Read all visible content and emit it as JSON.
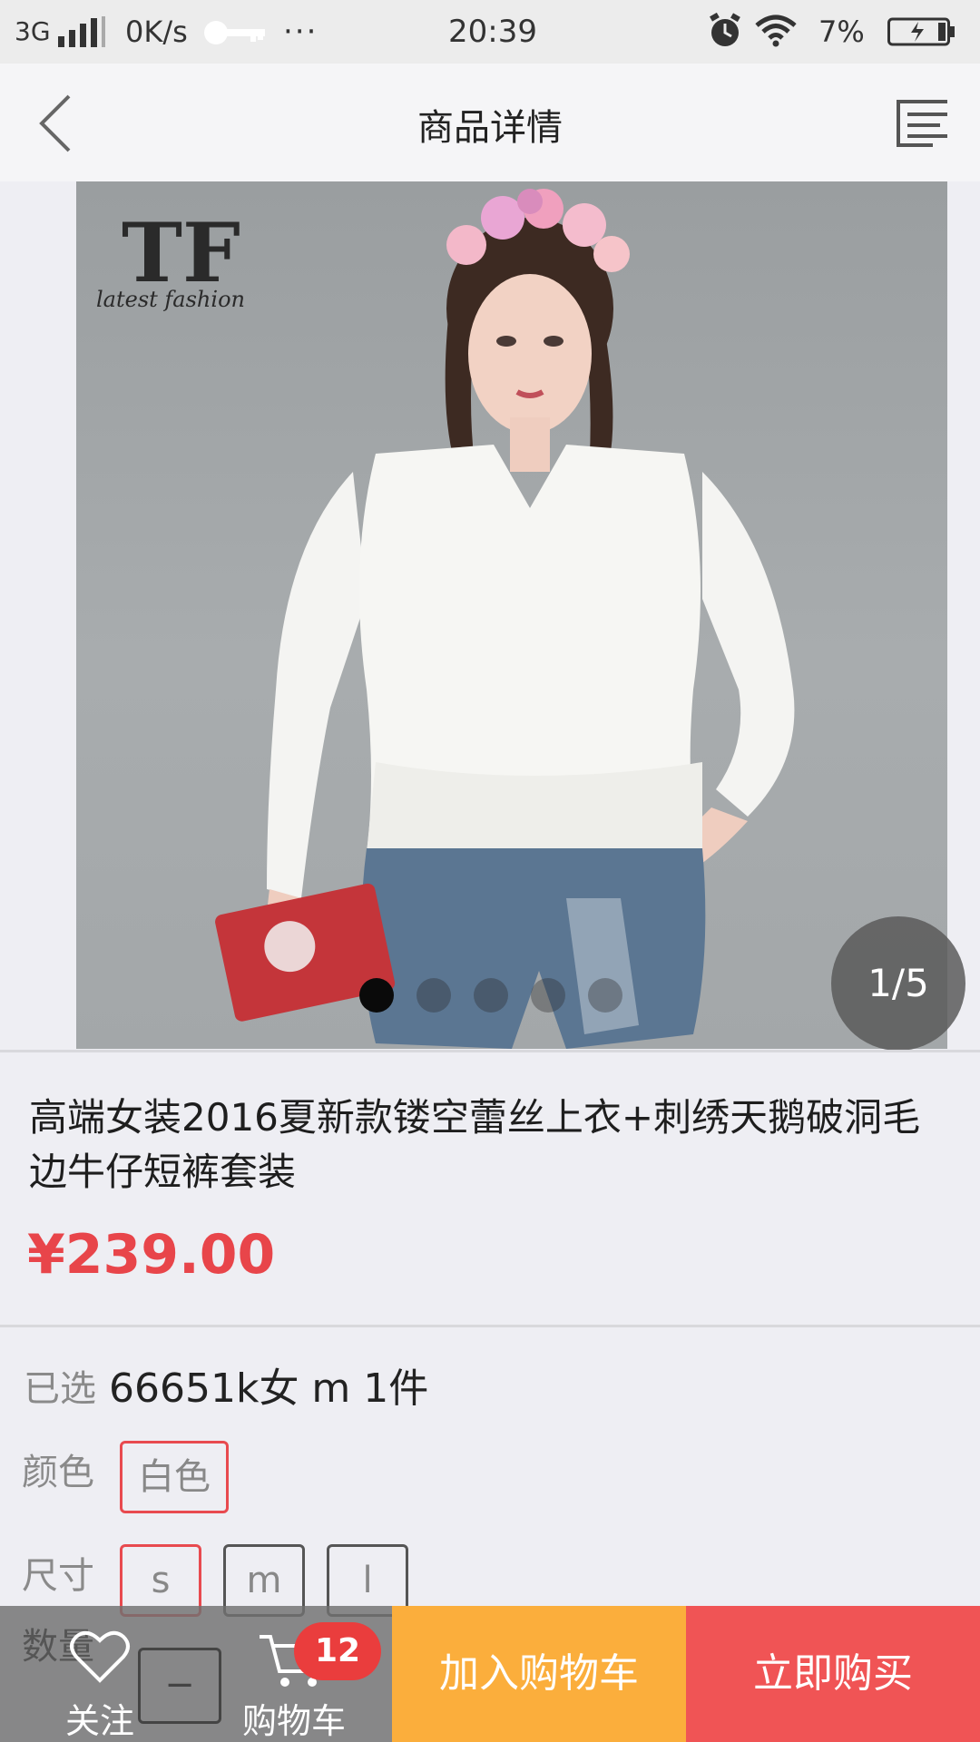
{
  "status_bar": {
    "network": "3G",
    "speed": "0K/s",
    "more": "···",
    "time": "20:39",
    "battery_text": "7%",
    "icons": [
      "signal-icon",
      "key-icon",
      "alarm-icon",
      "wifi-icon",
      "battery-charging-icon"
    ]
  },
  "nav": {
    "title": "商品详情",
    "back_icon": "chevron-left-icon",
    "menu_icon": "list-menu-icon"
  },
  "gallery": {
    "logo_text": "TF",
    "logo_sub": "latest fashion",
    "counter": "1/5",
    "current": 1,
    "total": 5
  },
  "product": {
    "title": "高端女装2016夏新款镂空蕾丝上衣+刺绣天鹅破洞毛边牛仔短裤套装",
    "price": "¥239.00"
  },
  "selection": {
    "label": "已选",
    "value": "66651k女 m 1件",
    "color_label": "颜色",
    "colors": [
      "白色"
    ],
    "size_label": "尺寸",
    "sizes": [
      "s",
      "m",
      "l"
    ],
    "quantity_label": "数量",
    "minus": "−"
  },
  "bottom_bar": {
    "favorite_label": "关注",
    "cart_label": "购物车",
    "cart_count": "12",
    "add_to_cart": "加入购物车",
    "buy_now": "立即购买",
    "colors": {
      "add_to_cart": "#fbae3c",
      "buy_now": "#f05455",
      "price": "#e8454a"
    }
  }
}
